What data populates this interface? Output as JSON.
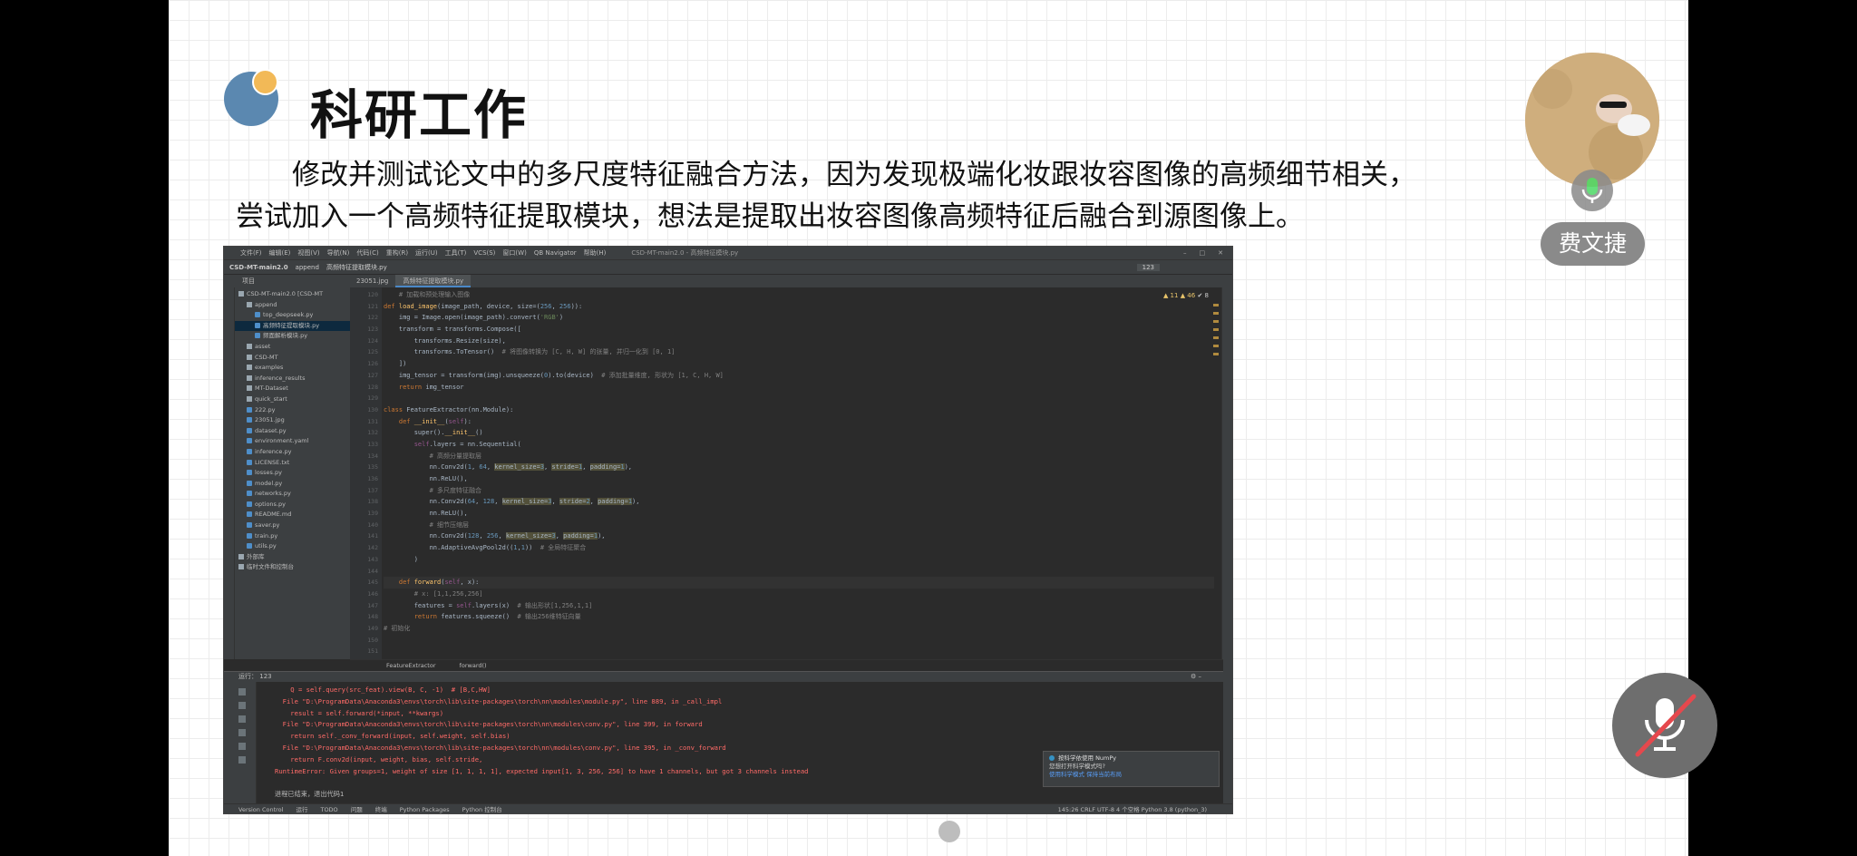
{
  "slide": {
    "title": "科研工作",
    "para_line1": "修改并测试论文中的多尺度特征融合方法，因为发现极端化妆跟妆容图像的高频细节相关，",
    "para_line2": "尝试加入一个高频特征提取模块，想法是提取出妆容图像高频特征后融合到源图像上。"
  },
  "ide": {
    "menu": [
      "文件(F)",
      "编辑(E)",
      "视图(V)",
      "导航(N)",
      "代码(C)",
      "重构(R)",
      "运行(U)",
      "工具(T)",
      "VCS(S)",
      "窗口(W)",
      "QB Navigator",
      "帮助(H)"
    ],
    "window_title": "CSD-MT-main2.0 - 高频特征模块.py",
    "nav_path": [
      "CSD-MT-main2.0",
      "append",
      "高频特征提取模块.py"
    ],
    "run_config": "123",
    "project_header": "项目",
    "tabs": [
      "23051.jpg",
      "高频特征提取模块.py"
    ],
    "inspections": {
      "warnings": "▲ 11",
      "weak": "▲ 46",
      "typos": "✔ 8"
    },
    "tree": [
      {
        "label": "CSD-MT-main2.0 [CSD-MT",
        "type": "folder",
        "indent": 0
      },
      {
        "label": "append",
        "type": "folder",
        "indent": 1
      },
      {
        "label": "top_deepseek.py",
        "type": "file",
        "indent": 2
      },
      {
        "label": "高频特征提取模块.py",
        "type": "file",
        "indent": 2,
        "selected": true
      },
      {
        "label": "频面解析模块.py",
        "type": "file",
        "indent": 2
      },
      {
        "label": "asset",
        "type": "folder",
        "indent": 1
      },
      {
        "label": "CSD-MT",
        "type": "folder",
        "indent": 1
      },
      {
        "label": "examples",
        "type": "folder",
        "indent": 1
      },
      {
        "label": "inference_results",
        "type": "folder",
        "indent": 1
      },
      {
        "label": "MT-Dataset",
        "type": "folder",
        "indent": 1
      },
      {
        "label": "quick_start",
        "type": "folder",
        "indent": 1
      },
      {
        "label": "222.py",
        "type": "file",
        "indent": 1
      },
      {
        "label": "23051.jpg",
        "type": "file",
        "indent": 1
      },
      {
        "label": "dataset.py",
        "type": "file",
        "indent": 1
      },
      {
        "label": "environment.yaml",
        "type": "file",
        "indent": 1
      },
      {
        "label": "inference.py",
        "type": "file",
        "indent": 1
      },
      {
        "label": "LICENSE.txt",
        "type": "file",
        "indent": 1
      },
      {
        "label": "losses.py",
        "type": "file",
        "indent": 1
      },
      {
        "label": "model.py",
        "type": "file",
        "indent": 1
      },
      {
        "label": "networks.py",
        "type": "file",
        "indent": 1
      },
      {
        "label": "options.py",
        "type": "file",
        "indent": 1
      },
      {
        "label": "README.md",
        "type": "file",
        "indent": 1
      },
      {
        "label": "saver.py",
        "type": "file",
        "indent": 1
      },
      {
        "label": "train.py",
        "type": "file",
        "indent": 1
      },
      {
        "label": "utils.py",
        "type": "file",
        "indent": 1
      },
      {
        "label": "外部库",
        "type": "folder",
        "indent": 0
      },
      {
        "label": "临时文件和控制台",
        "type": "folder",
        "indent": 0
      }
    ],
    "line_numbers": [
      "120",
      "121",
      "122",
      "123",
      "124",
      "125",
      "126",
      "127",
      "128",
      "129",
      "130",
      "131",
      "132",
      "133",
      "134",
      "135",
      "136",
      "137",
      "138",
      "139",
      "140",
      "141",
      "142",
      "143",
      "144",
      "145",
      "146",
      "147",
      "148",
      "149",
      "150",
      "151",
      "152"
    ],
    "crumbs": [
      "FeatureExtractor",
      "forward()"
    ],
    "run_header": "运行：",
    "run_tab": "123",
    "console": [
      {
        "t": "    Q = self.query(src_feat).view(B, C, -1)  # [B,C,HW]",
        "k": "err"
      },
      {
        "t": "  File \"D:\\ProgramData\\Anaconda3\\envs\\torch\\lib\\site-packages\\torch\\nn\\modules\\module.py\", line 889, in _call_impl",
        "k": "lnk"
      },
      {
        "t": "    result = self.forward(*input, **kwargs)",
        "k": "err"
      },
      {
        "t": "  File \"D:\\ProgramData\\Anaconda3\\envs\\torch\\lib\\site-packages\\torch\\nn\\modules\\conv.py\", line 399, in forward",
        "k": "lnk"
      },
      {
        "t": "    return self._conv_forward(input, self.weight, self.bias)",
        "k": "err"
      },
      {
        "t": "  File \"D:\\ProgramData\\Anaconda3\\envs\\torch\\lib\\site-packages\\torch\\nn\\modules\\conv.py\", line 395, in _conv_forward",
        "k": "lnk"
      },
      {
        "t": "    return F.conv2d(input, weight, bias, self.stride,",
        "k": "err"
      },
      {
        "t": "RuntimeError: Given groups=1, weight of size [1, 1, 1, 1], expected input[1, 3, 256, 256] to have 1 channels, but got 3 channels instead",
        "k": "err"
      },
      {
        "t": "",
        "k": "norm"
      },
      {
        "t": "进程已结束，退出代码1",
        "k": "norm"
      }
    ],
    "notification": {
      "title": "按科学依使用 NumPy",
      "body": "您想打开科学模式吗?",
      "actions": "使用科学模式    保持当前布局"
    },
    "bottom_tabs": [
      "Version Control",
      "运行",
      "TODO",
      "问题",
      "终端",
      "Python Packages",
      "Python 控制台"
    ],
    "status": "145:26  CRLF  UTF-8  4 个空格  Python 3.8 (python_3)"
  },
  "overlay": {
    "presenter_name": "费文捷"
  },
  "colors": {
    "logo_blue": "#5b88b0",
    "logo_orange": "#f2b957",
    "ide_bg": "#2b2b2b",
    "error_red": "#ff6b68"
  }
}
